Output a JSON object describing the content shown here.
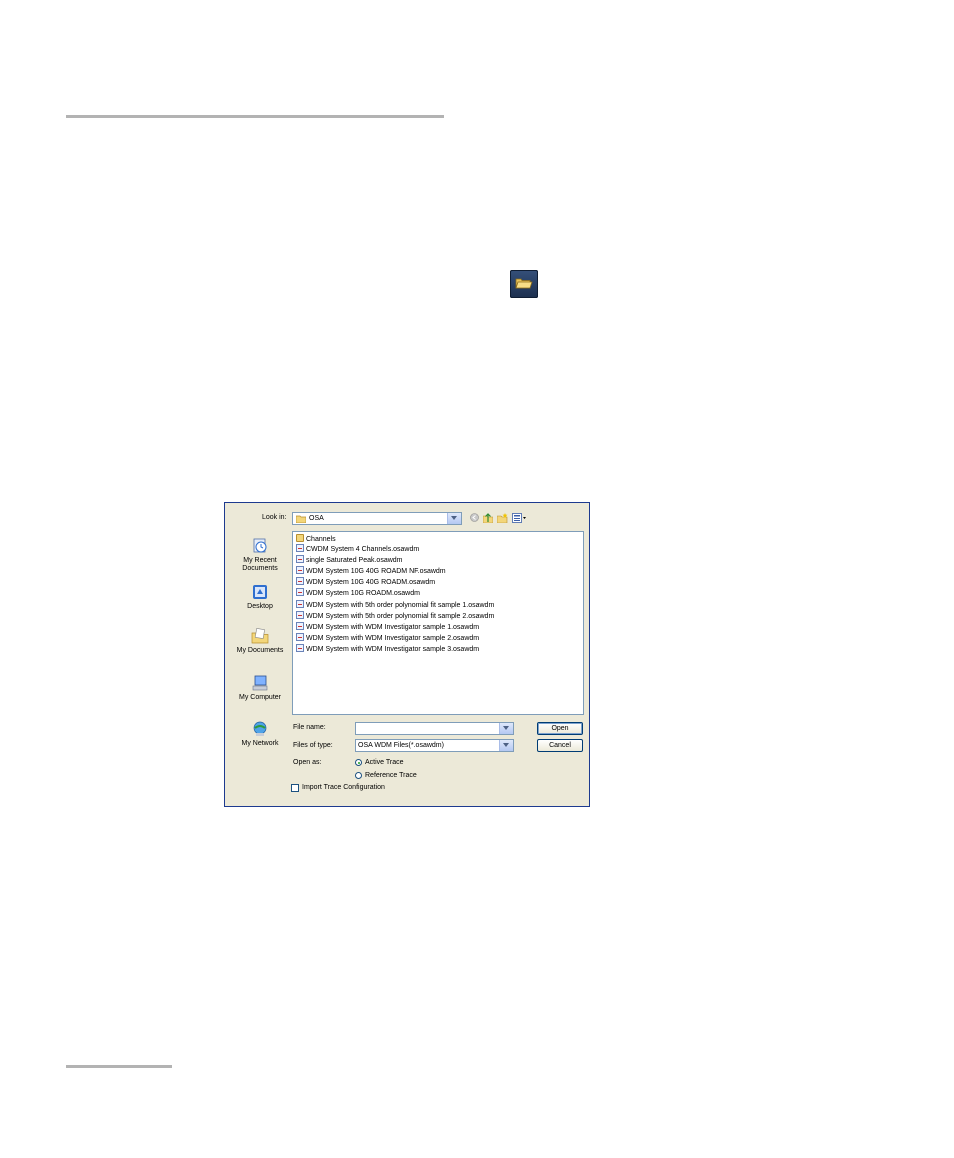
{
  "toolbar": {
    "open_icon": "open-folder-icon"
  },
  "dialog": {
    "look_in_label": "Look in:",
    "look_in_value": "OSA",
    "places": [
      {
        "label_line1": "My Recent",
        "label_line2": "Documents",
        "icon": "recent-documents-icon"
      },
      {
        "label_line1": "Desktop",
        "label_line2": "",
        "icon": "desktop-icon"
      },
      {
        "label_line1": "My Documents",
        "label_line2": "",
        "icon": "my-documents-icon"
      },
      {
        "label_line1": "My Computer",
        "label_line2": "",
        "icon": "my-computer-icon"
      },
      {
        "label_line1": "My Network",
        "label_line2": "",
        "icon": "my-network-icon"
      }
    ],
    "files": [
      {
        "name": "Channels",
        "type": "folder"
      },
      {
        "name": "CWDM System 4 Channels.osawdm",
        "type": "file"
      },
      {
        "name": "single Saturated Peak.osawdm",
        "type": "file"
      },
      {
        "name": "WDM System 10G 40G ROADM NF.osawdm",
        "type": "file"
      },
      {
        "name": "WDM System 10G 40G ROADM.osawdm",
        "type": "file"
      },
      {
        "name": "WDM System 10G ROADM.osawdm",
        "type": "file"
      },
      {
        "name": "WDM System with 5th order polynomial fit sample 1.osawdm",
        "type": "file"
      },
      {
        "name": "WDM System with 5th order polynomial fit sample 2.osawdm",
        "type": "file"
      },
      {
        "name": "WDM System with WDM Investigator sample 1.osawdm",
        "type": "file"
      },
      {
        "name": "WDM System with WDM Investigator sample 2.osawdm",
        "type": "file"
      },
      {
        "name": "WDM System with WDM Investigator sample 3.osawdm",
        "type": "file"
      }
    ],
    "file_name_label": "File name:",
    "file_name_value": "",
    "file_type_label": "Files of type:",
    "file_type_value": "OSA WDM Files(*.osawdm)",
    "open_button": "Open",
    "cancel_button": "Cancel",
    "open_as_label": "Open as:",
    "radio_active": "Active Trace",
    "radio_reference": "Reference Trace",
    "import_checkbox": "Import Trace Configuration"
  }
}
